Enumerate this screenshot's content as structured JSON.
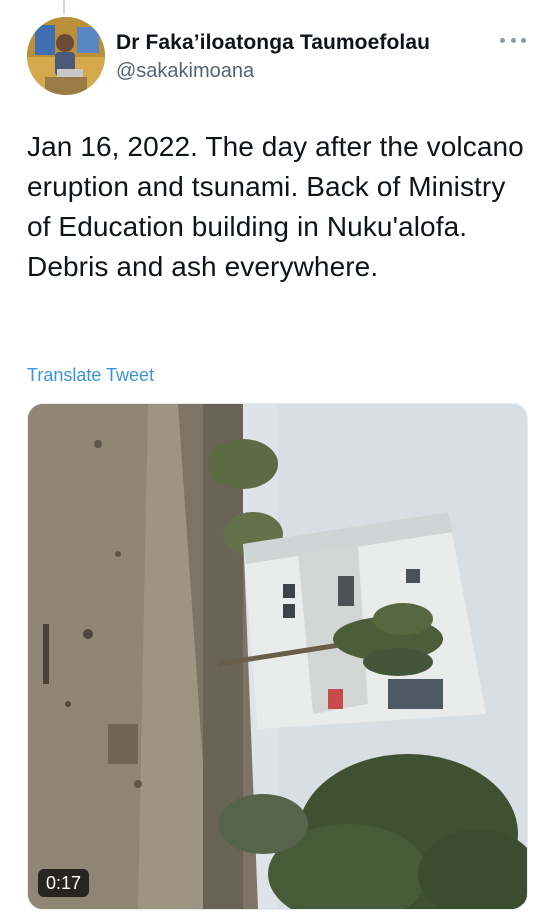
{
  "author": {
    "display_name": "Dr Faka’iloatonga Taumoefolau",
    "handle": "@sakakimoana",
    "avatar_icon": "profile-photo"
  },
  "tweet": {
    "text": "Jan 16, 2022. The day after the volcano eruption and tsunami. Back of Ministry of Education building in Nuku'alofa. Debris and ash everywhere.",
    "translate_label": "Translate Tweet"
  },
  "media": {
    "type": "video",
    "duration": "0:17"
  },
  "colors": {
    "link": "#3b94d9",
    "secondary_text": "#536471",
    "thread_line": "#cfd9de"
  },
  "icons": {
    "more": "more-horizontal-icon"
  }
}
